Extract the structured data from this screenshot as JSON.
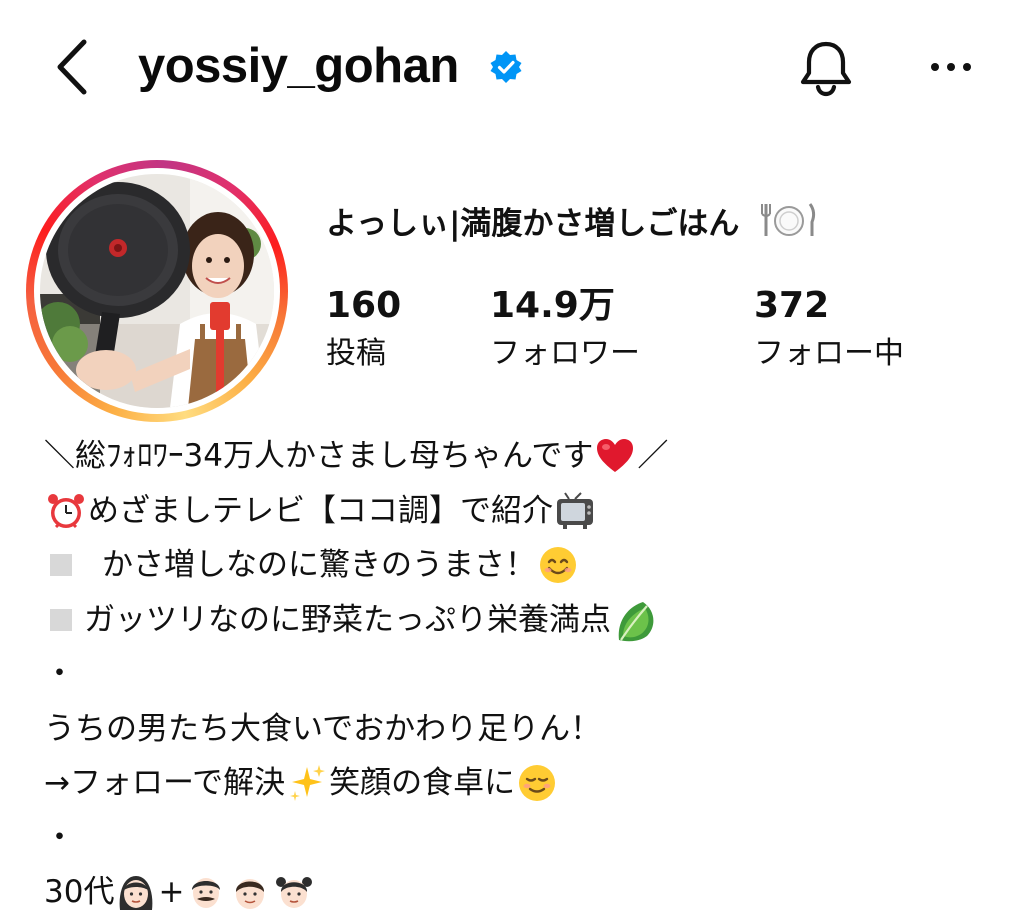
{
  "header": {
    "username": "yossiy_gohan",
    "verified": true,
    "back_icon": "chevron-left-icon",
    "bell_icon": "bell-icon",
    "more_icon": "ellipsis-icon"
  },
  "profile": {
    "display_name": "よっしぃ|満腹かさ増しごはん",
    "display_name_emoji": "fork-plate-knife-icon",
    "stats": {
      "posts": {
        "value": "160",
        "label": "投稿"
      },
      "followers": {
        "value": "14.9万",
        "label": "フォロワー"
      },
      "following": {
        "value": "372",
        "label": "フォロー中"
      }
    }
  },
  "bio": {
    "line1": {
      "text": "＼総ﾌｫﾛﾜｰ34万人かさまし母ちゃんです",
      "emoji": "red-heart-icon",
      "tail": " ／"
    },
    "line2": {
      "emoji": "alarm-clock-icon",
      "text": "めざましテレビ【ココ調】で紹介",
      "tail_emoji": "television-icon"
    },
    "line3": {
      "text": "かさ増しなのに驚きのうまさ！",
      "emoji": "smiling-face-icon"
    },
    "line4": {
      "text": "ガッツリなのに野菜たっぷり栄養満点",
      "emoji": "leafy-green-icon"
    },
    "line5": {
      "text": "・"
    },
    "line6": {
      "text": "うちの男たち大食いでおかわり足りん！"
    },
    "line7": {
      "text_a": "→フォローで解決",
      "emoji_a": "sparkles-icon",
      "text_b": "笑顔の食卓に",
      "emoji_b": "relieved-smile-icon"
    },
    "line8": {
      "text": "・"
    },
    "line9": {
      "text": "30代",
      "plus": "+",
      "family_emojis": [
        "woman-icon",
        "man-mustache-icon",
        "boy-icon",
        "girl-icon"
      ]
    }
  },
  "colors": {
    "text": "#111111",
    "verified_blue": "#0095f6",
    "ring_start": "#fcaf45",
    "ring_end": "#e1306c"
  }
}
